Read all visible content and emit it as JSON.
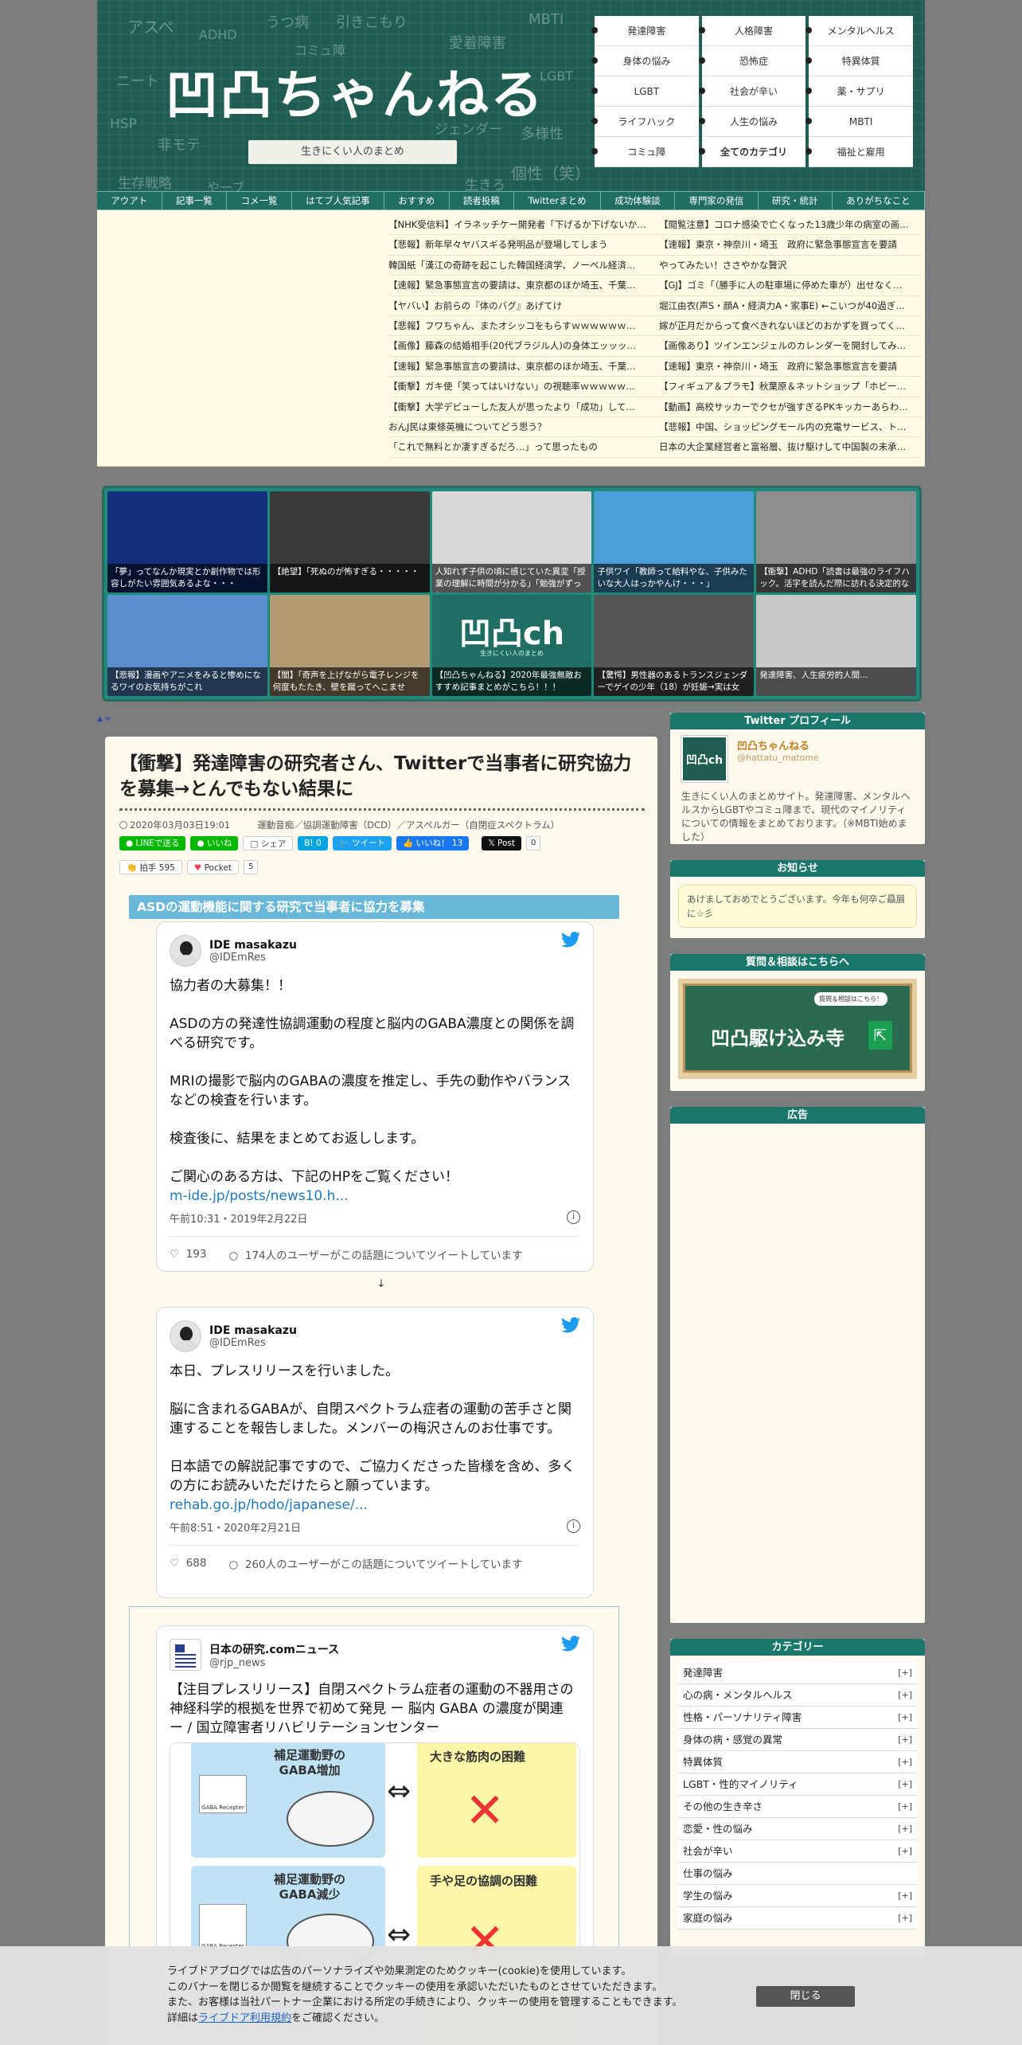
{
  "header": {
    "title": "凹凸ちゃんねる",
    "tagline": "生きにくい人のまとめ",
    "chalk_words": [
      "アスペ",
      "ADHD",
      "うつ病",
      "引きこもり",
      "MBTI",
      "コミュ障",
      "愛着障害",
      "ニート",
      "LGBT",
      "HSP",
      "非モテ",
      "ジェンダー",
      "多様性",
      "生存戦略",
      "やーブ",
      "生きろ",
      "個性（笑）"
    ],
    "nav": [
      {
        "label": "発達障害",
        "bold": false
      },
      {
        "label": "人格障害",
        "bold": false
      },
      {
        "label": "メンタルヘルス",
        "bold": false
      },
      {
        "label": "身体の悩み",
        "bold": false
      },
      {
        "label": "恐怖症",
        "bold": false
      },
      {
        "label": "特異体質",
        "bold": false
      },
      {
        "label": "LGBT",
        "bold": false
      },
      {
        "label": "社会が辛い",
        "bold": false
      },
      {
        "label": "薬・サプリ",
        "bold": false
      },
      {
        "label": "ライフハック",
        "bold": false
      },
      {
        "label": "人生の悩み",
        "bold": false
      },
      {
        "label": "MBTI",
        "bold": false
      },
      {
        "label": "コミュ障",
        "bold": false
      },
      {
        "label": "全てのカテゴリ",
        "bold": true
      },
      {
        "label": "福祉と雇用",
        "bold": false
      }
    ]
  },
  "global_nav": [
    "アウアト",
    "記事一覧",
    "コメ一覧",
    "はてブ人気記事",
    "おすすめ",
    "読者投稿",
    "Twitterまとめ",
    "成功体験談",
    "専門家の発信",
    "研究・統計",
    "ありがちなこと"
  ],
  "antenna": [
    "【NHK受信料】イラネッチケー開発者「下げるか下げないか…",
    "【閲覧注意】コロナ感染で亡くなった13歳少年の病室の画…",
    "【悲報】新年早々ヤバスギる発明品が登場してしまう",
    "【速報】東京・神奈川・埼玉　政府に緊急事態宣言を要請",
    "韓国紙「漢江の奇跡を起こした韓国経済学、ノーベル経済…",
    "やってみたい！ささやかな贅沢",
    "【速報】緊急事態宣言の要請は、東京都のほか埼玉、千葉…",
    "【GJ】ゴミ「（勝手に人の駐車場に停めた車が）出せなく…",
    "【ヤバい】お前らの『体のバグ』あげてけ",
    "堀江由衣(声S・顔A・経済力A・家事E) ←こいつが40過ぎ…",
    "【悲報】フワちゃん、またオシッコをもらすｗｗｗｗｗｗ…",
    "嫁が正月だからって食べきれないほどのおかずを買ってく…",
    "【画像】藤森の結婚相手(20代ブラジル人)の身体エッッッ…",
    "【画像あり】ツインエンジェルのカレンダーを開封してみ…",
    "【速報】緊急事態宣言の要請は、東京都のほか埼玉、千葉…",
    "【速報】東京・神奈川・埼玉　政府に緊急事態宣言を要請",
    "【衝撃】ガキ使「笑ってはいけない」の視聴率ｗｗｗｗｗ…",
    "【フィギュア＆プラモ】秋葉原＆ネットショップ「ホビー…",
    "【衝撃】大学デビューした友人が思ったより「成功」して…",
    "【動画】高校サッカーでクセが強すぎるPKキッカーあらわ…",
    "おんJ民は東條英機についてどう思う？",
    "【悲報】中国、ショッピングモール内の充電サービス、ト…",
    "「これで無料とか凄すぎるだろ…」って思ったもの",
    "日本の大企業経営者と富裕層、抜け駆けして中国製の未承…"
  ],
  "gallery": [
    {
      "caption": "「夢」ってなんか現実とか創作物では形容しがたい雰囲気あるよな・・・",
      "color": "#14307a"
    },
    {
      "caption": "【絶望】「死ぬのが怖すぎる・・・・・",
      "color": "#3a3a3a"
    },
    {
      "caption": "人知れず子供の頃に感じていた異変「授業の理解に時間が分かる」「勉強がずっと",
      "color": "#d8d8d8"
    },
    {
      "caption": "子供ワイ「教師って給料やな、子供みたいな大人はっかやんけ・・・」",
      "color": "#4a9fd6"
    },
    {
      "caption": "【衝撃】ADHD「読書は最強のライフハック。活字を読んだ際に訪れる決定的な",
      "color": "#8e8e8e"
    },
    {
      "caption": "【悲報】漫画やアニメをみると惨めになるワイのお気持ちがこれ",
      "color": "#5a8fcf"
    },
    {
      "caption": "【闇】「奇声を上げながら電子レンジを何度もたたき、壁を蹴ってへこませ",
      "color": "#b29a72"
    },
    {
      "caption": "【凹凸ちゃんねる】2020年最強無敵おすすめ記事まとめがこちら！！！",
      "color": "#1f6d63"
    },
    {
      "caption": "【驚愕】男性器のあるトランスジェンダーでゲイの少年（18）が妊娠→実は女",
      "color": "#555"
    },
    {
      "caption": "発達障害、人生疲労的人間…",
      "color": "#c9c9c9"
    }
  ],
  "gallery_logo": "凹凸ch",
  "gallery_logo_sub": "生きにくい人のまとめ",
  "toplink": "▲ ≡",
  "article": {
    "title": "【衝撃】発達障害の研究者さん、Twitterで当事者に研究協力を募集→とんでもない結果に",
    "date": "2020年03月03日19:01",
    "tags": [
      "運動音痴／協調運動障害（DCD）",
      "アスペルガー（自閉症スペクトラム）"
    ],
    "share": {
      "line_send": "LINEで送る",
      "line_like": "いいね",
      "share": "シェア",
      "hatena": "B! 0",
      "tweet": "ツイート",
      "fb_like": "いいね！ 13",
      "post": "Post",
      "post_count": "0",
      "hakushu": "拍手",
      "hakushu_count": "595",
      "pocket": "Pocket",
      "pocket_count": "5"
    },
    "heading": "ASDの運動機能に関する研究で当事者に協力を募集",
    "arrow": "↓",
    "tweets": [
      {
        "name": "IDE masakazu",
        "handle": "@IDEmRes",
        "body": "協力者の大募集！！\n\nASDの方の発達性協調運動の程度と脳内のGABA濃度との関係を調べる研究です。\n\nMRIの撮影で脳内のGABAの濃度を推定し、手先の動作やバランスなどの検査を行います。\n\n検査後に、結果をまとめてお返しします。\n\nご関心のある方は、下記のHPをご覧ください！",
        "link": "m-ide.jp/posts/news10.h...",
        "time": "午前10:31・2019年2月22日",
        "likes": "193",
        "replies": "174人のユーザーがこの話題についてツイートしています"
      },
      {
        "name": "IDE masakazu",
        "handle": "@IDEmRes",
        "body": "本日、プレスリリースを行いました。\n\n脳に含まれるGABAが、自閉スペクトラム症者の運動の苦手さと関連することを報告しました。メンバーの梅沢さんのお仕事です。\n\n日本語での解説記事ですので、ご協力くださった皆様を含め、多くの方にお読みいただけたらと願っています。",
        "link": "rehab.go.jp/hodo/japanese/...",
        "time": "午前8:51・2020年2月21日",
        "likes": "688",
        "replies": "260人のユーザーがこの話題についてツイートしています"
      },
      {
        "name": "日本の研究.comニュース",
        "handle": "@rjp_news",
        "body": "【注目プレスリリース】自閉スペクトラム症者の運動の不器用さの神経科学的根拠を世界で初めて発見 ー 脳内 GABA の濃度が関連 ー / 国立障害者リハビリテーションセンター"
      }
    ],
    "figure": {
      "p1": "補足運動野の\nGABA増加",
      "p2": "大きな筋肉の困難",
      "p3": "補足運動野の\nGABA減少",
      "p4": "手や足の協調の困難",
      "receptor": "GABA Recepter"
    }
  },
  "sidebar": {
    "profile_title": "Twitter プロフィール",
    "profile_name": "凹凸ちゃんねる",
    "profile_handle": "@hattatu_matome",
    "profile_avatar": "凹凸ch",
    "profile_desc": "生きにくい人のまとめサイト。発達障害、メンタルヘルスからLGBTやコミュ障まで、現代のマイノリティについての情報をまとめております。（※MBTI始めました）",
    "notice_title": "お知らせ",
    "notice_text": "あけましておめでとうございます。今年も何卒ご贔屓に☆彡",
    "qa_title": "質問＆相談はこちらへ",
    "qa_banner": "凹凸駆け込み寺",
    "qa_bubble": "質問＆相談はこちら！",
    "ad_title": "広告",
    "cat_title": "カテゴリー",
    "categories": [
      {
        "label": "発達障害",
        "plus": true
      },
      {
        "label": "心の病・メンタルヘルス",
        "plus": true
      },
      {
        "label": "性格・パーソナリティ障害",
        "plus": true
      },
      {
        "label": "身体の病・感覚の異常",
        "plus": true
      },
      {
        "label": "特異体質",
        "plus": true
      },
      {
        "label": "LGBT・性的マイノリティ",
        "plus": true
      },
      {
        "label": "その他の生き辛さ",
        "plus": true
      },
      {
        "label": "恋愛・性の悩み",
        "plus": true
      },
      {
        "label": "社会が辛い",
        "plus": true
      },
      {
        "label": "仕事の悩み",
        "plus": false
      },
      {
        "label": "学生の悩み",
        "plus": true
      },
      {
        "label": "家庭の悩み",
        "plus": true
      }
    ]
  },
  "cookie": {
    "line1": "ライブドアブログでは広告のパーソナライズや効果測定のためクッキー(cookie)を使用しています。",
    "line2": "このバナーを閉じるか閲覧を継続することでクッキーの使用を承認いただいたものとさせていただきます。",
    "line3": "また、お客様は当社パートナー企業における所定の手続きにより、クッキーの使用を管理することもできます。",
    "line4_pre": "詳細は",
    "line4_link": "ライブドア利用規約",
    "line4_post": "をご確認ください。",
    "close": "閉じる"
  },
  "colors": {
    "header_bg": "#1f5d52",
    "nav_bg": "#1f6d63",
    "accent": "#19776b",
    "link": "#1d79c1",
    "heading": "#6ab8d9"
  }
}
